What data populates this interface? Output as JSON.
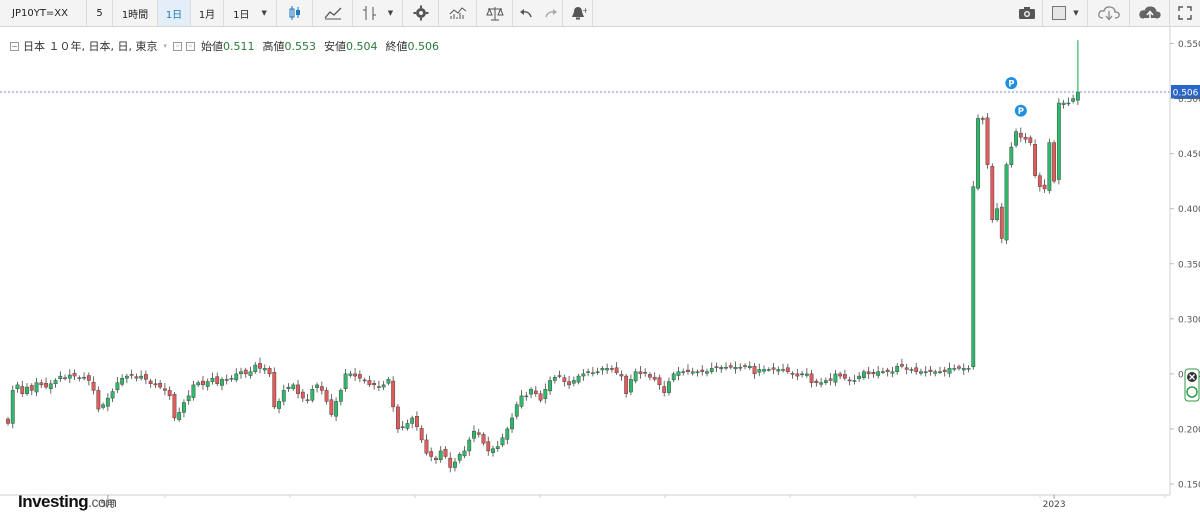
{
  "toolbar": {
    "symbol": "JP10YT=XX",
    "interval_value": "5",
    "interval_1h": "1時間",
    "interval_1d": "1日",
    "interval_1m": "1月",
    "range_select": "1日",
    "icons": [
      "candlestick-icon",
      "area-chart-icon",
      "indicator-icon",
      "settings-icon",
      "studies-icon",
      "compare-icon",
      "undo-icon",
      "redo-icon",
      "alert-icon",
      "camera-icon",
      "layout-box-icon",
      "cloud-download-icon",
      "cloud-upload-icon",
      "fullscreen-icon"
    ]
  },
  "legend": {
    "title": "日本 １０年, 日本, 日, 東京",
    "open_label": "始値",
    "open_value": "0.511",
    "high_label": "高値",
    "high_value": "0.553",
    "low_label": "安値",
    "low_value": "0.504",
    "close_label": "終値",
    "close_value": "0.506"
  },
  "brand": {
    "name": "Investing",
    "suffix": ".com"
  },
  "colors": {
    "up": "#2fb86a",
    "down": "#e05c5c",
    "price_line": "#3d66d9",
    "price_tag": "#2a66c9",
    "marker": "#1f8fe0"
  },
  "chart_data": {
    "type": "candlestick",
    "ylim": [
      0.14,
      0.565
    ],
    "y_ticks": [
      "0.150",
      "0.200",
      "0.250",
      "0.300",
      "0.350",
      "0.400",
      "0.450",
      "0.500",
      "0.550"
    ],
    "x_ticks": [
      {
        "label": "5月",
        "index": 21
      },
      {
        "label": "2023",
        "index": 220
      }
    ],
    "last_price": "0.506",
    "markers": [
      {
        "label": "P",
        "index": 211,
        "value": 0.514
      },
      {
        "label": "P",
        "index": 213,
        "value": 0.489
      }
    ],
    "closes": [
      0.205,
      0.235,
      0.24,
      0.232,
      0.238,
      0.235,
      0.242,
      0.24,
      0.238,
      0.241,
      0.244,
      0.248,
      0.246,
      0.249,
      0.248,
      0.246,
      0.247,
      0.244,
      0.235,
      0.218,
      0.222,
      0.228,
      0.234,
      0.242,
      0.246,
      0.248,
      0.249,
      0.246,
      0.248,
      0.245,
      0.241,
      0.24,
      0.238,
      0.235,
      0.23,
      0.21,
      0.215,
      0.224,
      0.23,
      0.24,
      0.242,
      0.24,
      0.243,
      0.246,
      0.241,
      0.245,
      0.244,
      0.246,
      0.25,
      0.252,
      0.25,
      0.252,
      0.258,
      0.255,
      0.255,
      0.25,
      0.22,
      0.225,
      0.235,
      0.238,
      0.24,
      0.232,
      0.228,
      0.226,
      0.236,
      0.24,
      0.235,
      0.225,
      0.213,
      0.225,
      0.235,
      0.25,
      0.25,
      0.248,
      0.246,
      0.244,
      0.24,
      0.24,
      0.238,
      0.24,
      0.245,
      0.22,
      0.2,
      0.202,
      0.205,
      0.21,
      0.202,
      0.19,
      0.178,
      0.175,
      0.172,
      0.18,
      0.175,
      0.165,
      0.17,
      0.177,
      0.18,
      0.19,
      0.198,
      0.195,
      0.187,
      0.18,
      0.182,
      0.184,
      0.192,
      0.2,
      0.21,
      0.222,
      0.23,
      0.23,
      0.236,
      0.232,
      0.226,
      0.236,
      0.244,
      0.247,
      0.248,
      0.243,
      0.24,
      0.244,
      0.248,
      0.25,
      0.252,
      0.251,
      0.252,
      0.255,
      0.255,
      0.254,
      0.251,
      0.248,
      0.232,
      0.245,
      0.252,
      0.25,
      0.251,
      0.247,
      0.245,
      0.24,
      0.233,
      0.243,
      0.25,
      0.252,
      0.252,
      0.252,
      0.252,
      0.252,
      0.252,
      0.252,
      0.255,
      0.256,
      0.256,
      0.256,
      0.256,
      0.256,
      0.256,
      0.257,
      0.257,
      0.25,
      0.254,
      0.254,
      0.254,
      0.254,
      0.254,
      0.254,
      0.252,
      0.25,
      0.248,
      0.25,
      0.25,
      0.242,
      0.242,
      0.242,
      0.244,
      0.244,
      0.25,
      0.248,
      0.246,
      0.244,
      0.244,
      0.248,
      0.252,
      0.25,
      0.25,
      0.252,
      0.252,
      0.252,
      0.252,
      0.257,
      0.257,
      0.254,
      0.254,
      0.252,
      0.252,
      0.252,
      0.252,
      0.252,
      0.252,
      0.252,
      0.255,
      0.255,
      0.255,
      0.255,
      0.255,
      0.42,
      0.482,
      0.481,
      0.44,
      0.39,
      0.4,
      0.373,
      0.44,
      0.456,
      0.47,
      0.465,
      0.463,
      0.46,
      0.43,
      0.42,
      0.418,
      0.46,
      0.425,
      0.496,
      0.496,
      0.496,
      0.5,
      0.506
    ]
  }
}
